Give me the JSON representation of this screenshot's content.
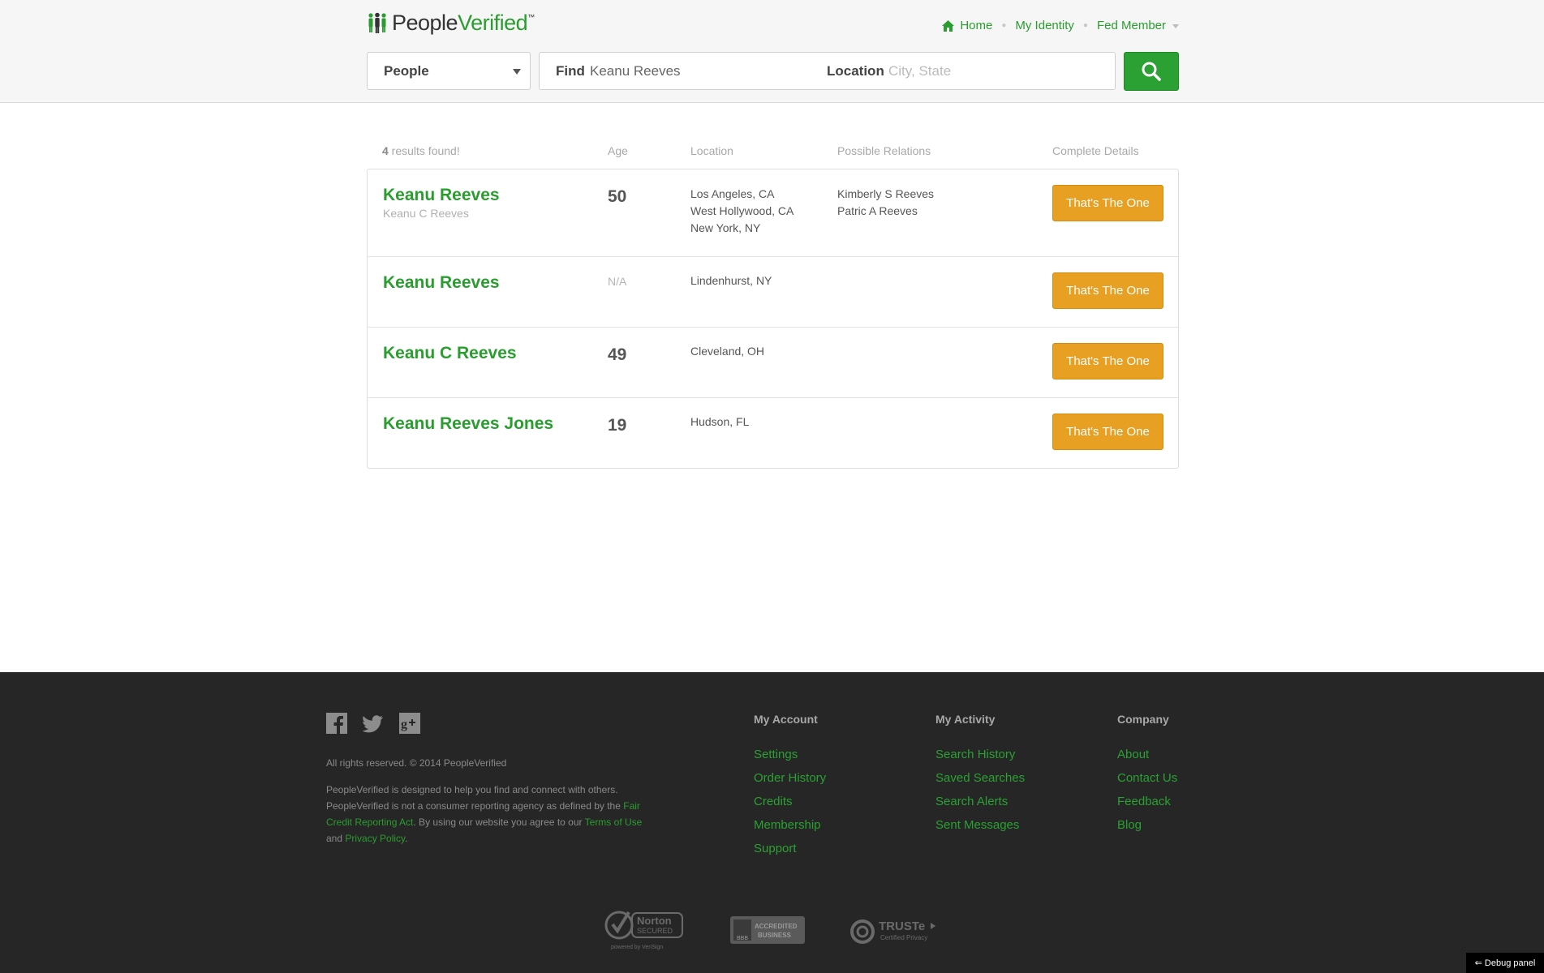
{
  "header": {
    "logo_people": "People",
    "logo_verified": "Verified",
    "logo_tm": "™",
    "nav": {
      "home": "Home",
      "my_identity": "My Identity",
      "member": "Fed Member"
    },
    "search": {
      "type_selected": "People",
      "find_label": "Find",
      "find_value": "Keanu Reeves",
      "location_label": "Location",
      "location_placeholder": "City, State"
    }
  },
  "results": {
    "count": "4",
    "count_suffix": " results found!",
    "columns": {
      "age": "Age",
      "location": "Location",
      "relations": "Possible Relations",
      "details": "Complete Details"
    },
    "button_label": "That's The One",
    "rows": [
      {
        "name": "Keanu Reeves",
        "aka": "Keanu C Reeves",
        "age": "50",
        "locations": [
          "Los Angeles, CA",
          "West Hollywood, CA",
          "New York, NY"
        ],
        "relations": [
          "Kimberly S Reeves",
          "Patric A Reeves"
        ]
      },
      {
        "name": "Keanu Reeves",
        "aka": "",
        "age": "N/A",
        "locations": [
          "Lindenhurst, NY"
        ],
        "relations": []
      },
      {
        "name": "Keanu C Reeves",
        "aka": "",
        "age": "49",
        "locations": [
          "Cleveland, OH"
        ],
        "relations": []
      },
      {
        "name": "Keanu Reeves Jones",
        "aka": "",
        "age": "19",
        "locations": [
          "Hudson, FL"
        ],
        "relations": []
      }
    ]
  },
  "footer": {
    "copyright": "All rights reserved. © 2014 PeopleVerified",
    "disclaimer_1": "PeopleVerified is designed to help you find and connect with others. PeopleVerified is not a consumer reporting agency as defined by the ",
    "fcra_link": "Fair Credit Reporting Act",
    "disclaimer_2": ". By using our website you agree to our ",
    "terms_link": "Terms of Use",
    "disclaimer_3": " and ",
    "privacy_link": "Privacy Policy",
    "disclaimer_4": ".",
    "columns": [
      {
        "title": "My Account",
        "links": [
          "Settings",
          "Order History",
          "Credits",
          "Membership",
          "Support"
        ]
      },
      {
        "title": "My Activity",
        "links": [
          "Search History",
          "Saved Searches",
          "Search Alerts",
          "Sent Messages"
        ]
      },
      {
        "title": "Company",
        "links": [
          "About",
          "Contact Us",
          "Feedback",
          "Blog"
        ]
      }
    ],
    "badges": {
      "norton_1": "Norton",
      "norton_2": "SECURED",
      "norton_3": "powered by VeriSign",
      "bbb_1": "ACCREDITED",
      "bbb_2": "BUSINESS",
      "bbb_3": "BBB",
      "truste_1": "TRUSTe",
      "truste_2": "Certified Privacy"
    },
    "debug": "⇐ Debug panel"
  },
  "icons": [
    "logo-people-icon",
    "home-icon",
    "search-icon",
    "facebook-icon",
    "twitter-icon",
    "google-plus-icon",
    "norton-badge-icon",
    "bbb-badge-icon",
    "truste-badge-icon"
  ],
  "colors": {
    "brand_green": "#2a9d2f",
    "button_orange": "#e8a023",
    "footer_bg": "#262626"
  }
}
